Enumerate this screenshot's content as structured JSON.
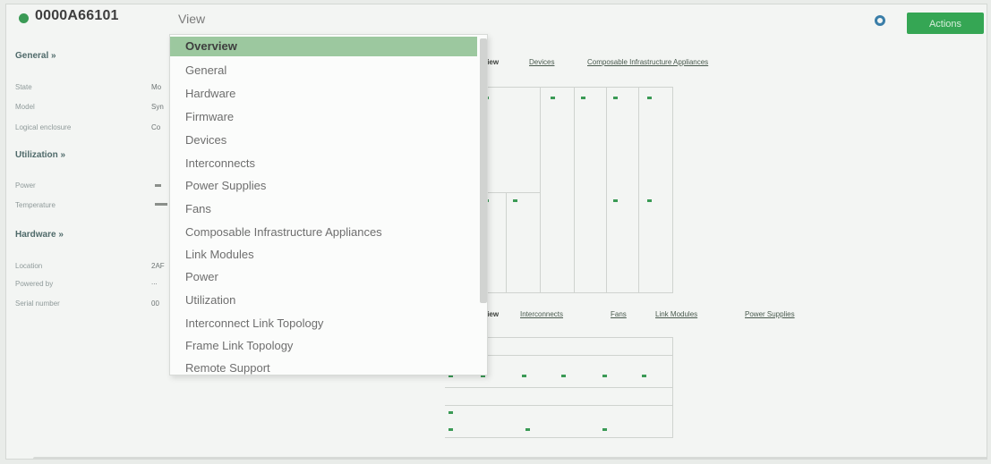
{
  "header": {
    "title": "0000A66101",
    "view_label": "View",
    "actions_label": "Actions",
    "status_color": "#3a9a55"
  },
  "left_panel": {
    "general_heading": "General »",
    "general_fields": [
      {
        "label": "State",
        "value": "Mo"
      },
      {
        "label": "Model",
        "value": "Syn"
      },
      {
        "label": "Logical enclosure",
        "value": "Co"
      }
    ],
    "utilization_heading": "Utilization »",
    "utilization_fields": [
      {
        "label": "Power"
      },
      {
        "label": "Temperature"
      }
    ],
    "hardware_heading": "Hardware »",
    "hardware_fields": [
      {
        "label": "Location",
        "value": "2AF"
      },
      {
        "label": "Powered by",
        "value": "..."
      },
      {
        "label": "Serial number",
        "value": "00"
      }
    ]
  },
  "main_panel": {
    "top_tabs": [
      "View",
      "Devices",
      "Composable Infrastructure Appliances"
    ],
    "bottom_tabs": [
      "View",
      "Interconnects",
      "Fans",
      "Link Modules",
      "Power Supplies"
    ]
  },
  "view_dropdown": {
    "selected": "Overview",
    "items": [
      "Overview",
      "General",
      "Hardware",
      "Firmware",
      "Devices",
      "Interconnects",
      "Power Supplies",
      "Fans",
      "Composable Infrastructure Appliances",
      "Link Modules",
      "Power",
      "Utilization",
      "Interconnect Link Topology",
      "Frame Link Topology",
      "Remote Support"
    ]
  }
}
